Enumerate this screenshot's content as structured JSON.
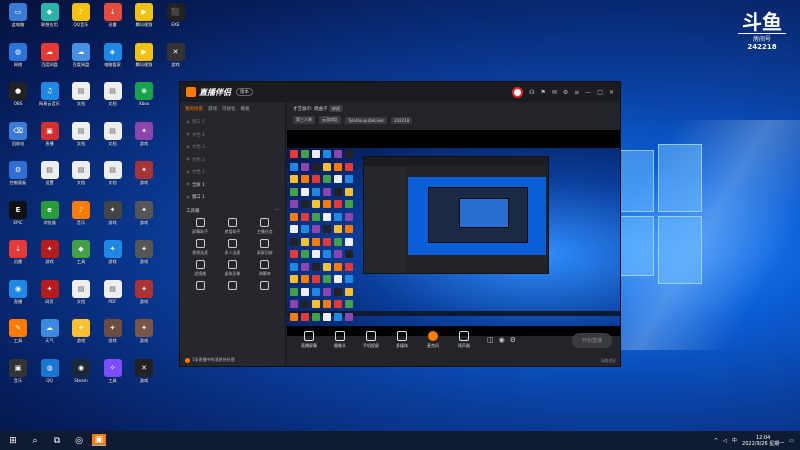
{
  "desktop": {
    "icons": [
      {
        "label": "此电脑",
        "color": "#3a7bd5",
        "glyph": "▭",
        "col": 0,
        "row": 0
      },
      {
        "label": "联想应用",
        "color": "#2ab3a6",
        "glyph": "◆",
        "col": 1,
        "row": 0
      },
      {
        "label": "QQ音乐",
        "color": "#f4c20d",
        "glyph": "♪",
        "col": 2,
        "row": 0
      },
      {
        "label": "迅雷",
        "color": "#e64a3b",
        "glyph": "⇣",
        "col": 3,
        "row": 0
      },
      {
        "label": "腾讯视频",
        "color": "#f4c20d",
        "glyph": "▶",
        "col": 4,
        "row": 0
      },
      {
        "label": "EXE",
        "color": "#222",
        "glyph": "⬛",
        "col": 5,
        "row": 0
      },
      {
        "label": "网络",
        "color": "#2a73d9",
        "glyph": "◍",
        "col": 0,
        "row": 1
      },
      {
        "label": "百度网盘",
        "color": "#e53935",
        "glyph": "☁",
        "col": 1,
        "row": 1
      },
      {
        "label": "百度网盘",
        "color": "#4a90e2",
        "glyph": "☁",
        "col": 2,
        "row": 1
      },
      {
        "label": "电脑管家",
        "color": "#1e88e5",
        "glyph": "◈",
        "col": 3,
        "row": 1
      },
      {
        "label": "腾讯视频",
        "color": "#f4c20d",
        "glyph": "▶",
        "col": 4,
        "row": 1
      },
      {
        "label": "游戏",
        "color": "#333",
        "glyph": "✕",
        "col": 5,
        "row": 1
      },
      {
        "label": "OBS",
        "color": "#222",
        "glyph": "●",
        "col": 0,
        "row": 2
      },
      {
        "label": "网易云音乐",
        "color": "#1e88e5",
        "glyph": "♫",
        "col": 1,
        "row": 2
      },
      {
        "label": "文档",
        "color": "#eee",
        "glyph": "▤",
        "col": 2,
        "row": 2
      },
      {
        "label": "文档",
        "color": "#eee",
        "glyph": "▤",
        "col": 3,
        "row": 2
      },
      {
        "label": "Xbox",
        "color": "#16a34a",
        "glyph": "⊗",
        "col": 4,
        "row": 2
      },
      {
        "label": "回收站",
        "color": "#3a7bd5",
        "glyph": "⌫",
        "col": 0,
        "row": 3
      },
      {
        "label": "直播",
        "color": "#d32f2f",
        "glyph": "▣",
        "col": 1,
        "row": 3
      },
      {
        "label": "文档",
        "color": "#eee",
        "glyph": "▤",
        "col": 2,
        "row": 3
      },
      {
        "label": "文档",
        "color": "#eee",
        "glyph": "▤",
        "col": 3,
        "row": 3
      },
      {
        "label": "游戏",
        "color": "#8e44ad",
        "glyph": "✦",
        "col": 4,
        "row": 3
      },
      {
        "label": "控制面板",
        "color": "#2f6fd1",
        "glyph": "⚙",
        "col": 0,
        "row": 4
      },
      {
        "label": "设置",
        "color": "#eee",
        "glyph": "▤",
        "col": 1,
        "row": 4
      },
      {
        "label": "文档",
        "color": "#eee",
        "glyph": "▤",
        "col": 2,
        "row": 4
      },
      {
        "label": "文档",
        "color": "#eee",
        "glyph": "▤",
        "col": 3,
        "row": 4
      },
      {
        "label": "游戏",
        "color": "#a33",
        "glyph": "✦",
        "col": 4,
        "row": 4
      },
      {
        "label": "EPIC",
        "color": "#111",
        "glyph": "E",
        "col": 0,
        "row": 5
      },
      {
        "label": "浏览器",
        "color": "#2a9d3b",
        "glyph": "e",
        "col": 1,
        "row": 5
      },
      {
        "label": "音乐",
        "color": "#ff7a00",
        "glyph": "♪",
        "col": 2,
        "row": 5
      },
      {
        "label": "游戏",
        "color": "#444",
        "glyph": "✦",
        "col": 3,
        "row": 5
      },
      {
        "label": "游戏",
        "color": "#555",
        "glyph": "✦",
        "col": 4,
        "row": 5
      },
      {
        "label": "迅雷",
        "color": "#e53935",
        "glyph": "⇣",
        "col": 0,
        "row": 6
      },
      {
        "label": "游戏",
        "color": "#b71c1c",
        "glyph": "✦",
        "col": 1,
        "row": 6
      },
      {
        "label": "工具",
        "color": "#43a047",
        "glyph": "◆",
        "col": 2,
        "row": 6
      },
      {
        "label": "游戏",
        "color": "#1e88e5",
        "glyph": "✦",
        "col": 3,
        "row": 6
      },
      {
        "label": "游戏",
        "color": "#555",
        "glyph": "✦",
        "col": 4,
        "row": 6
      },
      {
        "label": "直播",
        "color": "#1e88e5",
        "glyph": "◉",
        "col": 0,
        "row": 7
      },
      {
        "label": "网页",
        "color": "#b71c1c",
        "glyph": "✦",
        "col": 1,
        "row": 7
      },
      {
        "label": "文档",
        "color": "#eee",
        "glyph": "▤",
        "col": 2,
        "row": 7
      },
      {
        "label": "PDF",
        "color": "#eee",
        "glyph": "▤",
        "col": 3,
        "row": 7
      },
      {
        "label": "游戏",
        "color": "#a33",
        "glyph": "✦",
        "col": 4,
        "row": 7
      },
      {
        "label": "工具",
        "color": "#ff7a00",
        "glyph": "✎",
        "col": 0,
        "row": 8
      },
      {
        "label": "天气",
        "color": "#3a8be0",
        "glyph": "☁",
        "col": 1,
        "row": 8
      },
      {
        "label": "游戏",
        "color": "#fbc02d",
        "glyph": "✦",
        "col": 2,
        "row": 8
      },
      {
        "label": "游戏",
        "color": "#6d4c41",
        "glyph": "✦",
        "col": 3,
        "row": 8
      },
      {
        "label": "游戏",
        "color": "#795548",
        "glyph": "✦",
        "col": 4,
        "row": 8
      },
      {
        "label": "音乐",
        "color": "#333",
        "glyph": "▣",
        "col": 0,
        "row": 9
      },
      {
        "label": "QQ",
        "color": "#1976d2",
        "glyph": "◍",
        "col": 1,
        "row": 9
      },
      {
        "label": "Steam",
        "color": "#1b2838",
        "glyph": "◉",
        "col": 2,
        "row": 9
      },
      {
        "label": "工具",
        "color": "#7b4dff",
        "glyph": "✧",
        "col": 3,
        "row": 9
      },
      {
        "label": "游戏",
        "color": "#222",
        "glyph": "✕",
        "col": 4,
        "row": 9
      }
    ]
  },
  "watermark": {
    "logo": "斗鱼",
    "subtitle": "房间号",
    "room": "242218"
  },
  "app": {
    "name": "直播伴侣",
    "version_badge": "版本",
    "left_tabs": [
      "我的场景",
      "游戏",
      "可视化",
      "模板"
    ],
    "scenes": [
      "窗口 5",
      "文档 4",
      "文档 3",
      "文档 2",
      "文档 1",
      "全屏 1",
      "窗口 1"
    ],
    "tools_header": "工具箱",
    "tools": [
      "屏幕助手",
      "房管助手",
      "主播任务",
      "视频连麦",
      "多人连麦",
      "录屏回放",
      "滤镜美",
      "虚拟形象",
      "弹幕库",
      "",
      "",
      ""
    ],
    "promo": "1条直播中的消息待处理",
    "main_title": "才艺展示: 唱曲子",
    "main_title_btn": "修改",
    "main_chips": [
      "第三人称",
      "云游戏区",
      "TyleDouyuDeLiver",
      "242218"
    ],
    "bottom_items": [
      "直播屏幕",
      "摄像头",
      "手机投屏",
      "多媒体",
      "麦克风",
      "扬声器"
    ],
    "start_live": "开始直播",
    "status": "网络良好"
  },
  "taskbar": {
    "icons": [
      "⊞",
      "⌕",
      "⧉",
      "◎",
      "▣"
    ],
    "tray": {
      "lang": "中",
      "time": "12:04",
      "date": "2022/9/26 星期一"
    }
  }
}
